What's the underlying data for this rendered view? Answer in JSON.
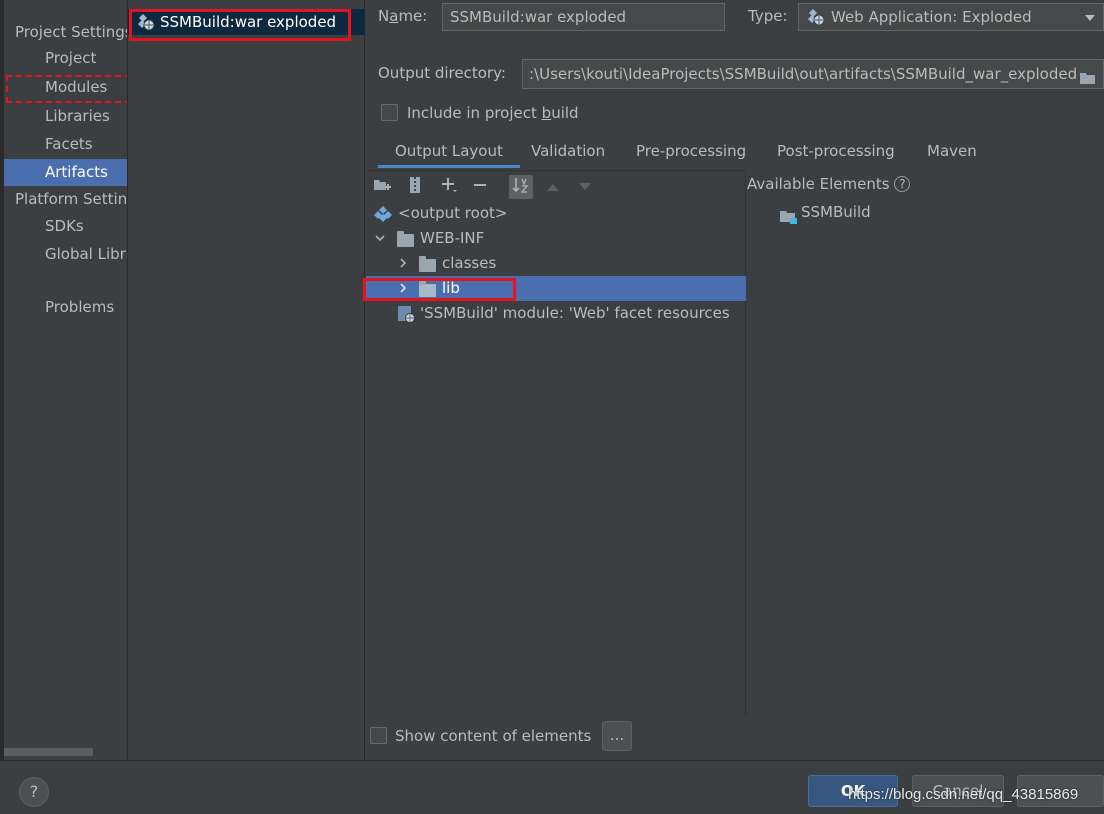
{
  "sidebar": {
    "project_settings_header": "Project Settings",
    "platform_settings_header": "Platform Settings",
    "items": [
      {
        "label": "Project"
      },
      {
        "label": "Modules"
      },
      {
        "label": "Libraries"
      },
      {
        "label": "Facets"
      },
      {
        "label": "Artifacts"
      },
      {
        "label": "SDKs"
      },
      {
        "label": "Global Libraries"
      },
      {
        "label": "Problems"
      }
    ]
  },
  "artifacts_list": {
    "items": [
      {
        "label": "SSMBuild:war exploded"
      }
    ]
  },
  "form": {
    "name_label_pre": "N",
    "name_label_u": "a",
    "name_label_post": "me:",
    "name_value": "SSMBuild:war exploded",
    "type_label": "Type:",
    "type_value": "Web Application: Exploded",
    "output_dir_label": "Output directory:",
    "output_dir_value": ":\\Users\\kouti\\IdeaProjects\\SSMBuild\\out\\artifacts\\SSMBuild_war_exploded",
    "include_label_pre": "Include in project ",
    "include_label_u": "b",
    "include_label_post": "uild"
  },
  "tabs": [
    {
      "label": "Output Layout"
    },
    {
      "label": "Validation"
    },
    {
      "label": "Pre-processing"
    },
    {
      "label": "Post-processing"
    },
    {
      "label": "Maven"
    }
  ],
  "tree": {
    "rows": [
      {
        "label": "<output root>"
      },
      {
        "label": "WEB-INF"
      },
      {
        "label": "classes"
      },
      {
        "label": "lib"
      },
      {
        "label": "'SSMBuild' module: 'Web' facet resources"
      }
    ]
  },
  "available": {
    "title": "Available Elements",
    "help_glyph": "?",
    "items": [
      {
        "label": "SSMBuild"
      }
    ]
  },
  "show_content": {
    "label": "Show content of elements",
    "more_button": "..."
  },
  "footer": {
    "help_glyph": "?",
    "ok_label": "OK",
    "cancel_label": "Cancel",
    "watermark": "https://blog.csdn.net/qq_43815869"
  },
  "colors": {
    "background": "#3c3f41",
    "selection": "#4b6eaf",
    "highlight_box": "#e3141e",
    "tab_underline": "#4a88c7"
  }
}
